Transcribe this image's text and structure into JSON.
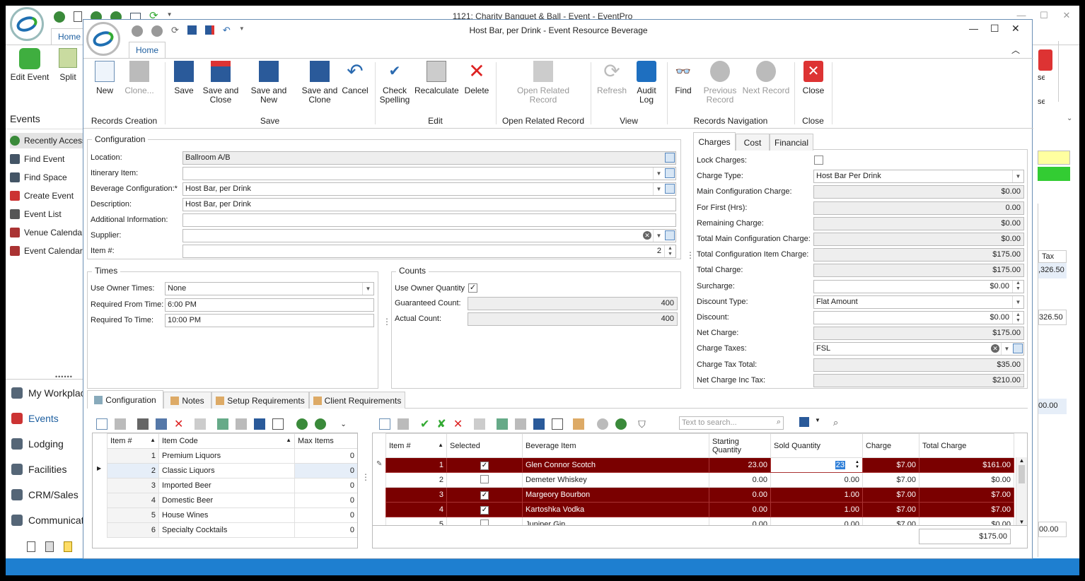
{
  "outer": {
    "title": "1121: Charity Banquet & Ball - Event - EventPro",
    "tab_home": "Home",
    "edit_event": "Edit Event",
    "split": "Split",
    "events_header": "Events",
    "side_items": [
      "Recently Accessed",
      "Find Event",
      "Find Space",
      "Create Event",
      "Event List",
      "Venue Calendar",
      "Event Calendar"
    ],
    "nav_items": [
      "My Workplace",
      "Events",
      "Lodging",
      "Facilities",
      "CRM/Sales",
      "Communication"
    ],
    "peek": {
      "tax": "Tax",
      "v1": ",326.50",
      "v2": "326.50",
      "v3": "00.00",
      "v4": "00.00"
    }
  },
  "inner": {
    "title": "Host Bar, per Drink - Event Resource Beverage",
    "tab_home": "Home",
    "toolbar": {
      "new": "New",
      "clone": "Clone...",
      "save": "Save",
      "save_close": "Save and Close",
      "save_new": "Save and New",
      "save_clone": "Save and Clone",
      "cancel": "Cancel",
      "check_spelling": "Check Spelling",
      "recalculate": "Recalculate",
      "delete": "Delete",
      "open_related": "Open Related Record",
      "refresh": "Refresh",
      "audit_log": "Audit Log",
      "find": "Find",
      "previous": "Previous Record",
      "next": "Next Record",
      "close": "Close"
    },
    "groups": {
      "records_creation": "Records Creation",
      "save": "Save",
      "edit": "Edit",
      "open_related": "Open Related Record",
      "view": "View",
      "records_navigation": "Records Navigation",
      "close": "Close"
    },
    "configuration": {
      "title": "Configuration",
      "location_label": "Location:",
      "location": "Ballroom A/B",
      "itinerary_label": "Itinerary Item:",
      "itinerary": "",
      "bev_config_label": "Beverage Configuration:*",
      "bev_config": "Host Bar, per Drink",
      "description_label": "Description:",
      "description": "Host Bar, per Drink",
      "additional_label": "Additional Information:",
      "additional": "",
      "supplier_label": "Supplier:",
      "supplier": "",
      "item_label": "Item #:",
      "item": "2"
    },
    "times": {
      "title": "Times",
      "owner_label": "Use Owner Times:",
      "owner": "None",
      "from_label": "Required From Time:",
      "from": "6:00 PM",
      "to_label": "Required To Time:",
      "to": "10:00 PM"
    },
    "counts": {
      "title": "Counts",
      "owner_qty_label": "Use Owner Quantity",
      "owner_qty_checked": true,
      "guaranteed_label": "Guaranteed Count:",
      "guaranteed": "400",
      "actual_label": "Actual Count:",
      "actual": "400"
    },
    "charges": {
      "tabs": [
        "Charges",
        "Cost",
        "Financial"
      ],
      "rows": [
        {
          "label": "Lock Charges:",
          "value": "",
          "kind": "check"
        },
        {
          "label": "Charge Type:",
          "value": "Host Bar Per Drink",
          "kind": "dd"
        },
        {
          "label": "Main Configuration Charge:",
          "value": "$0.00",
          "kind": "ro"
        },
        {
          "label": "For First (Hrs):",
          "value": "0.00",
          "kind": "ro"
        },
        {
          "label": "Remaining Charge:",
          "value": "$0.00",
          "kind": "ro"
        },
        {
          "label": "Total Main Configuration Charge:",
          "value": "$0.00",
          "kind": "ro"
        },
        {
          "label": "Total Configuration Item Charge:",
          "value": "$175.00",
          "kind": "ro"
        },
        {
          "label": "Total Charge:",
          "value": "$175.00",
          "kind": "ro"
        },
        {
          "label": "Surcharge:",
          "value": "$0.00",
          "kind": "spin"
        },
        {
          "label": "Discount Type:",
          "value": "Flat Amount",
          "kind": "dd"
        },
        {
          "label": "Discount:",
          "value": "$0.00",
          "kind": "spin"
        },
        {
          "label": "Net Charge:",
          "value": "$175.00",
          "kind": "ro"
        },
        {
          "label": "Charge Taxes:",
          "value": "FSL",
          "kind": "tax"
        },
        {
          "label": "Charge Tax Total:",
          "value": "$35.00",
          "kind": "ro"
        },
        {
          "label": "Net Charge Inc Tax:",
          "value": "$210.00",
          "kind": "ro"
        }
      ]
    },
    "bottom_tabs": [
      "Configuration",
      "Notes",
      "Setup Requirements",
      "Client Requirements"
    ],
    "config_grid": {
      "headers": [
        "Item #",
        "Item Code",
        "Max Items"
      ],
      "rows": [
        [
          "1",
          "Premium Liquors",
          "0"
        ],
        [
          "2",
          "Classic Liquors",
          "0"
        ],
        [
          "3",
          "Imported Beer",
          "0"
        ],
        [
          "4",
          "Domestic Beer",
          "0"
        ],
        [
          "5",
          "House Wines",
          "0"
        ],
        [
          "6",
          "Specialty Cocktails",
          "0"
        ]
      ]
    },
    "bev_grid": {
      "search_placeholder": "Text to search...",
      "headers": [
        "Item #",
        "Selected",
        "Beverage Item",
        "Starting Quantity",
        "Sold Quantity",
        "Charge",
        "Total Charge"
      ],
      "rows": [
        {
          "n": "1",
          "sel": true,
          "item": "Glen Connor Scotch",
          "start": "23.00",
          "sold": "23",
          "charge": "$7.00",
          "total": "$161.00"
        },
        {
          "n": "2",
          "sel": false,
          "item": "Demeter Whiskey",
          "start": "0.00",
          "sold": "0.00",
          "charge": "$7.00",
          "total": "$0.00"
        },
        {
          "n": "3",
          "sel": true,
          "item": "Margeory Bourbon",
          "start": "0.00",
          "sold": "1.00",
          "charge": "$7.00",
          "total": "$7.00"
        },
        {
          "n": "4",
          "sel": true,
          "item": "Kartoshka Vodka",
          "start": "0.00",
          "sold": "1.00",
          "charge": "$7.00",
          "total": "$7.00"
        },
        {
          "n": "5",
          "sel": false,
          "item": "Juniper Gin",
          "start": "0.00",
          "sold": "0.00",
          "charge": "$7.00",
          "total": "$0.00"
        }
      ],
      "footer_total": "$175.00"
    }
  },
  "colors": {
    "accent": "#1e7fd0",
    "selected_row": "#7a0000",
    "statusbar": "#1e7fd0"
  }
}
